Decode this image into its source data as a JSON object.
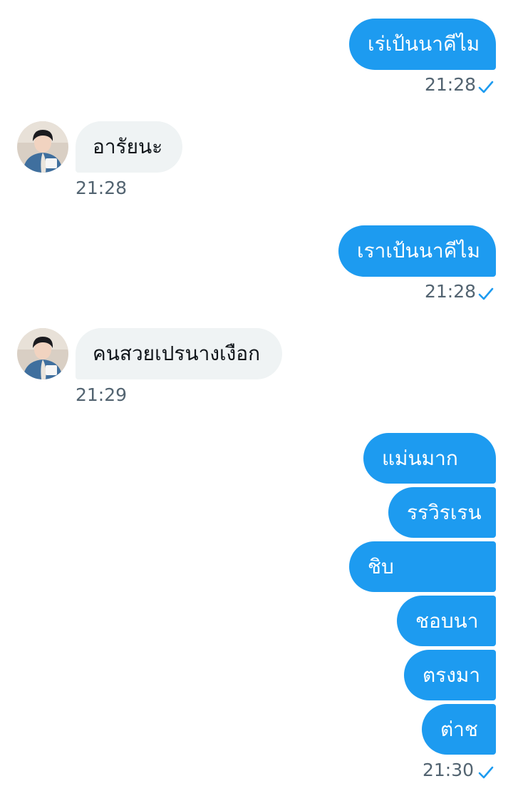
{
  "messages": [
    {
      "text": "เร่เป้นนาคีไม",
      "time": "21:28",
      "read": true
    },
    {
      "text": "อารัยนะ",
      "time": "21:28"
    },
    {
      "text": "เราเป้นนาคีไม",
      "time": "21:28",
      "read": true
    },
    {
      "text": "คนสวยเปรนางเงือก",
      "time": "21:29"
    },
    {
      "text": "แม่นมาก"
    },
    {
      "text": "รรวิรเรน"
    },
    {
      "text": "ชิบ"
    },
    {
      "text": "ชอบนา"
    },
    {
      "text": "ตรงมา"
    },
    {
      "text": "ต่าช",
      "time": "21:30",
      "read": true
    }
  ],
  "colors": {
    "outgoing_bubble": "#1d9bf0",
    "incoming_bubble": "#eff3f4",
    "timestamp": "#536471",
    "read_check": "#1d9bf0"
  },
  "icons": {
    "read_receipt": "checkmark-icon",
    "avatar": "contact-avatar"
  }
}
